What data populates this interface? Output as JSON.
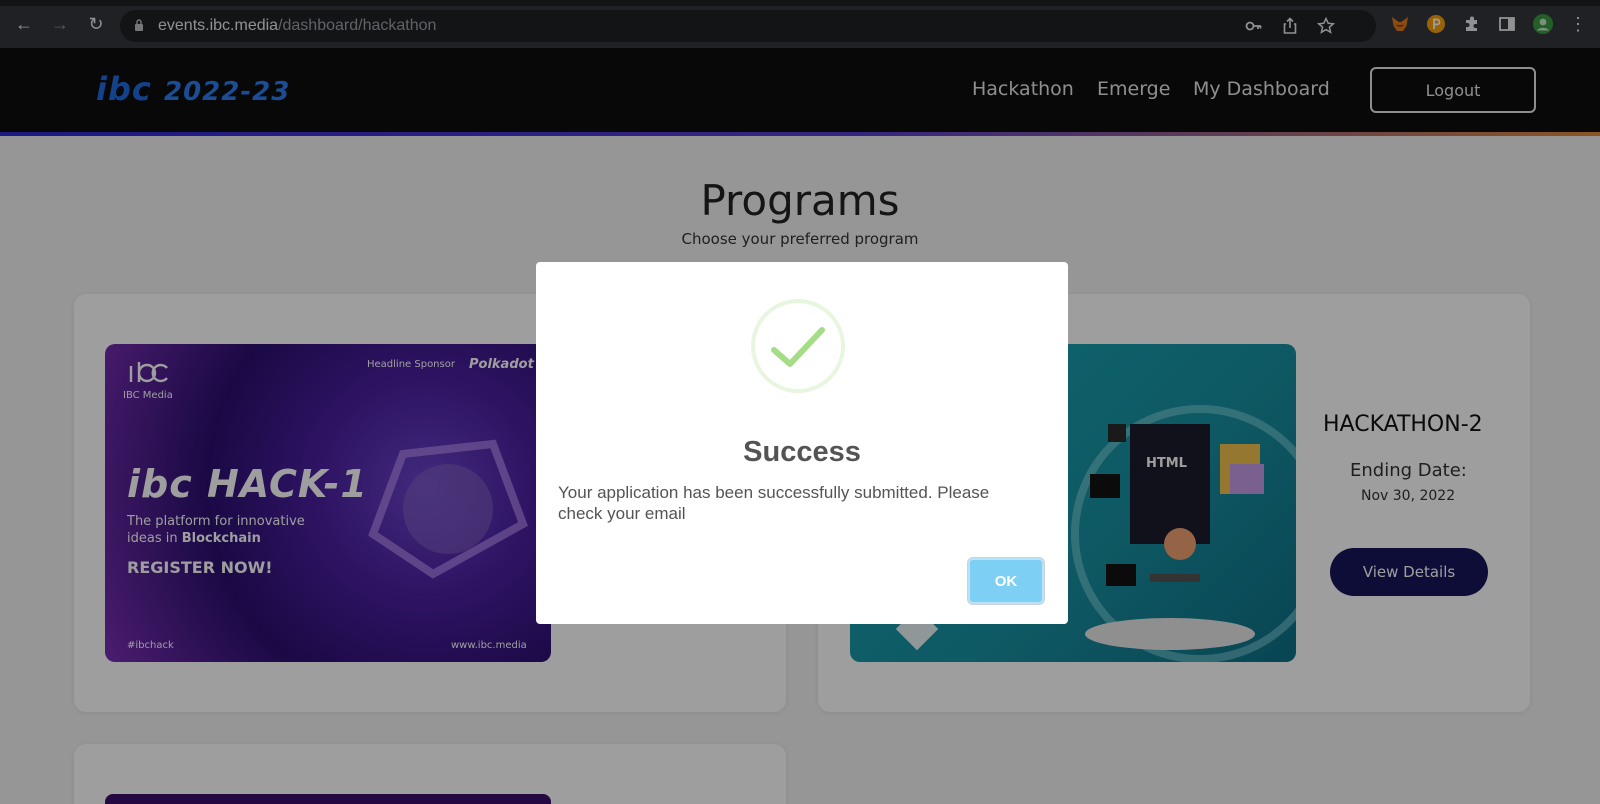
{
  "browser": {
    "url_host": "events.ibc.media",
    "url_path": "/dashboard/hackathon"
  },
  "header": {
    "logo_brand": "ibc",
    "logo_year": "2022-23",
    "nav": [
      "Hackathon",
      "Emerge",
      "My Dashboard"
    ],
    "logout_label": "Logout"
  },
  "page": {
    "title": "Programs",
    "subtitle": "Choose your preferred program"
  },
  "card1": {
    "brand": "IBC Media",
    "sponsor_label": "Headline Sponsor",
    "sponsor_name": "Polkadot",
    "hack_title": "ibc HACK-1",
    "tagline_1": "The platform for innovative",
    "tagline_2": "ideas in",
    "tagline_bold": "Blockchain",
    "cta": "REGISTER NOW!",
    "hashtag": "#ibchack",
    "website": "www.ibc.media"
  },
  "card2": {
    "banner_word": "HTML",
    "title": "HACKATHON-2",
    "ending_label": "Ending Date:",
    "ending_date": "Nov 30, 2022",
    "view_label": "View Details"
  },
  "modal": {
    "title": "Success",
    "message": "Your application has been successfully submitted. Please check your email",
    "ok_label": "OK"
  },
  "colors": {
    "header_bg": "#0d0d0d",
    "accent_navy": "#16155a",
    "ok_button": "#7ecff4",
    "success_green": "#a5dc86"
  }
}
